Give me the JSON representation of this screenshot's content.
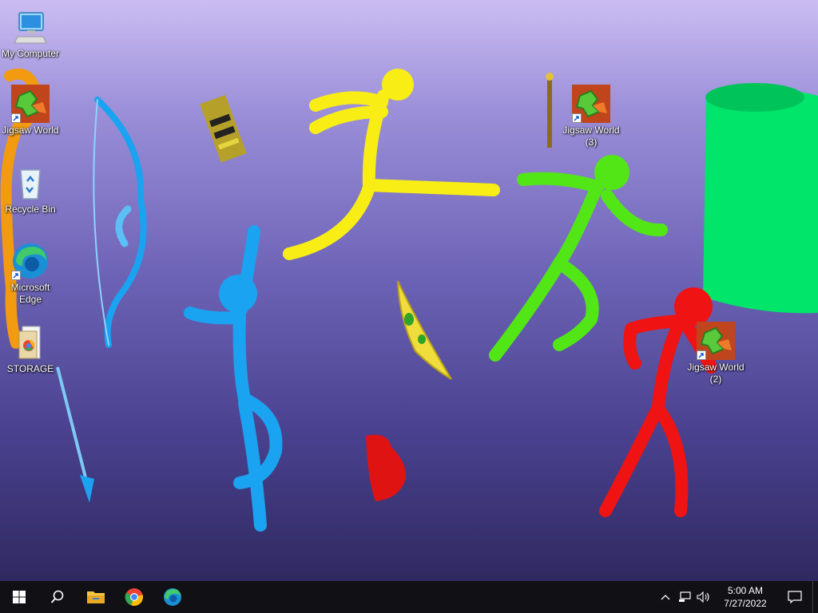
{
  "desktop": {
    "icons": [
      {
        "label": "My Computer"
      },
      {
        "label": "Jigsaw World"
      },
      {
        "label": "Recycle Bin"
      },
      {
        "label": "Microsoft Edge"
      },
      {
        "label": "STORAGE"
      },
      {
        "label": "Jigsaw World (3)"
      },
      {
        "label": "Jigsaw World (2)"
      }
    ]
  },
  "taskbar": {
    "start_icon": "windows-logo-icon",
    "search_icon": "search-icon",
    "pinned": [
      "file-explorer-icon",
      "chrome-icon",
      "edge-icon"
    ],
    "tray_icons": [
      "chevron-up-icon",
      "network-icon",
      "volume-icon"
    ],
    "time": "5:00 AM",
    "date": "7/27/2022",
    "notification_icon": "notification-icon"
  },
  "colors": {
    "stick_yellow": "#f8ee16",
    "stick_green": "#52e617",
    "stick_blue": "#1aa3f0",
    "stick_red": "#ef1313",
    "stick_orange": "#f29a10",
    "green_cylinder": "#00e56a"
  }
}
